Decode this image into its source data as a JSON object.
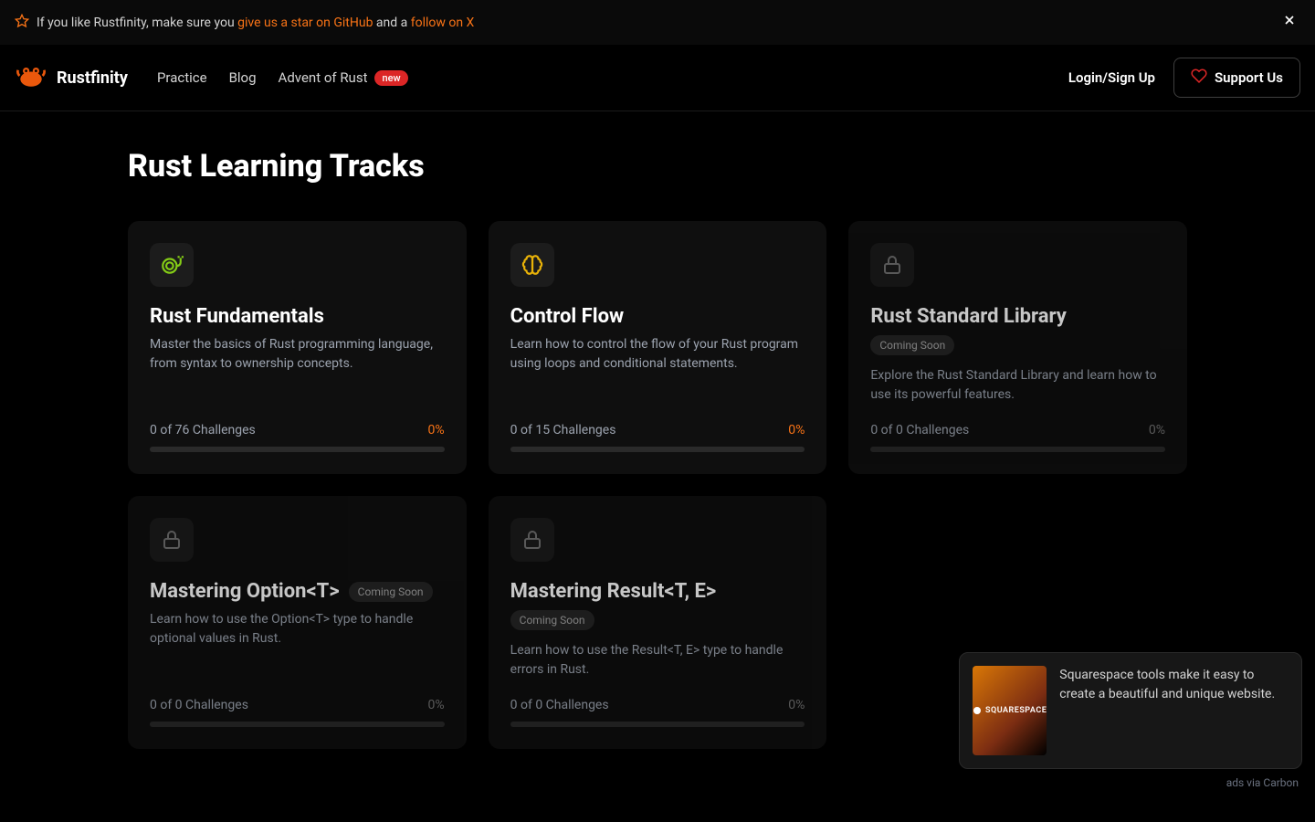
{
  "banner": {
    "pre_text": "If you like Rustfinity, make sure you ",
    "github_link": "give us a star on GitHub",
    "mid_text": " and a ",
    "x_link": "follow on X"
  },
  "nav": {
    "brand": "Rustfinity",
    "practice": "Practice",
    "blog": "Blog",
    "advent": "Advent of Rust",
    "new_badge": "new",
    "login": "Login/Sign Up",
    "support": "Support Us"
  },
  "page": {
    "title": "Rust Learning Tracks"
  },
  "tracks": [
    {
      "title": "Rust Fundamentals",
      "desc": "Master the basics of Rust programming language, from syntax to ownership concepts.",
      "challenges": "0 of 76 Challenges",
      "pct": "0%",
      "locked": false,
      "icon": "snail",
      "badge_mode": "none"
    },
    {
      "title": "Control Flow",
      "desc": "Learn how to control the flow of your Rust program using loops and conditional statements.",
      "challenges": "0 of 15 Challenges",
      "pct": "0%",
      "locked": false,
      "icon": "brain",
      "badge_mode": "none"
    },
    {
      "title": "Rust Standard Library",
      "coming_soon": "Coming Soon",
      "desc": "Explore the Rust Standard Library and learn how to use its powerful features.",
      "challenges": "0 of 0 Challenges",
      "pct": "0%",
      "locked": true,
      "icon": "lock",
      "badge_mode": "block"
    },
    {
      "title": "Mastering Option<T>",
      "coming_soon": "Coming Soon",
      "desc": "Learn how to use the Option<T> type to handle optional values in Rust.",
      "challenges": "0 of 0 Challenges",
      "pct": "0%",
      "locked": true,
      "icon": "lock",
      "badge_mode": "inline"
    },
    {
      "title": "Mastering Result<T, E>",
      "coming_soon": "Coming Soon",
      "desc": "Learn how to use the Result<T, E> type to handle errors in Rust.",
      "challenges": "0 of 0 Challenges",
      "pct": "0%",
      "locked": true,
      "icon": "lock",
      "badge_mode": "block"
    }
  ],
  "ad": {
    "label": "SQUARESPACE",
    "text": "Squarespace tools make it easy to create a beautiful and unique website.",
    "credit": "ads via Carbon"
  }
}
